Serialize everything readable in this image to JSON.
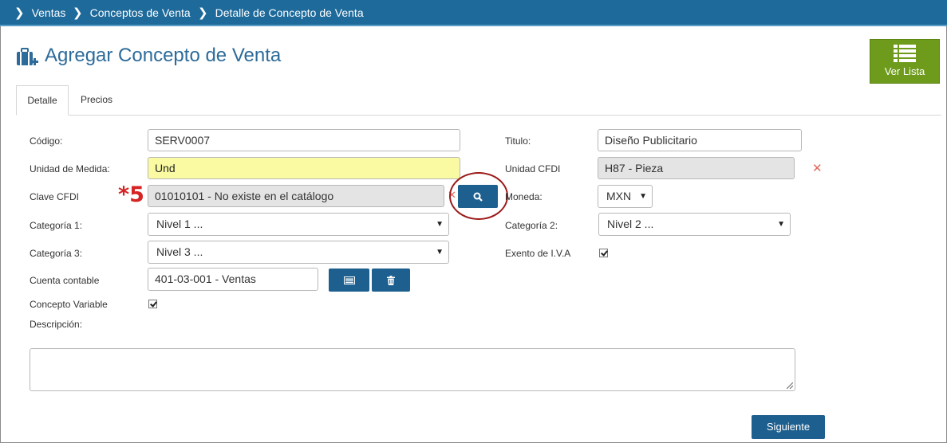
{
  "breadcrumb": [
    "Ventas",
    "Conceptos de Venta",
    "Detalle de Concepto de Venta"
  ],
  "page": {
    "title": "Agregar Concepto de Venta",
    "list_button": "Ver Lista"
  },
  "tabs": [
    {
      "label": "Detalle",
      "active": true
    },
    {
      "label": "Precios",
      "active": false
    }
  ],
  "form": {
    "codigo": {
      "label": "Código:",
      "value": "SERV0007"
    },
    "titulo": {
      "label": "Titulo:",
      "value": "Diseño Publicitario"
    },
    "unidad_medida": {
      "label": "Unidad de Medida:",
      "value": "Und"
    },
    "unidad_cfdi": {
      "label": "Unidad CFDI",
      "value": "H87 - Pieza"
    },
    "clave_cfdi": {
      "label": "Clave CFDI",
      "value": "01010101 - No existe en el catálogo"
    },
    "moneda": {
      "label": "Moneda:",
      "value": "MXN"
    },
    "categoria1": {
      "label": "Categoría 1:",
      "value": "Nivel 1 ..."
    },
    "categoria2": {
      "label": "Categoría 2:",
      "value": "Nivel 2 ..."
    },
    "categoria3": {
      "label": "Categoría 3:",
      "value": "Nivel 3 ..."
    },
    "exento_iva": {
      "label": "Exento de I.V.A",
      "checked": true
    },
    "cuenta_contable": {
      "label": "Cuenta contable",
      "value": "401-03-001 - Ventas"
    },
    "concepto_variable": {
      "label": "Concepto Variable",
      "checked": true
    },
    "descripcion": {
      "label": "Descripción:",
      "value": ""
    }
  },
  "annotation": "*5",
  "buttons": {
    "next": "Siguiente"
  },
  "colors": {
    "topbar": "#1d6a9b",
    "accent_blue": "#1d5f8e",
    "list_button": "#6e9b1c",
    "annotation_red": "#d62323",
    "highlight_yellow": "#fafaa2"
  },
  "icons": {
    "title": "briefcase-add-icon",
    "list": "list-icon",
    "search": "search-icon",
    "account_list": "card-list-icon",
    "delete": "trash-icon",
    "clear": "close-icon"
  }
}
